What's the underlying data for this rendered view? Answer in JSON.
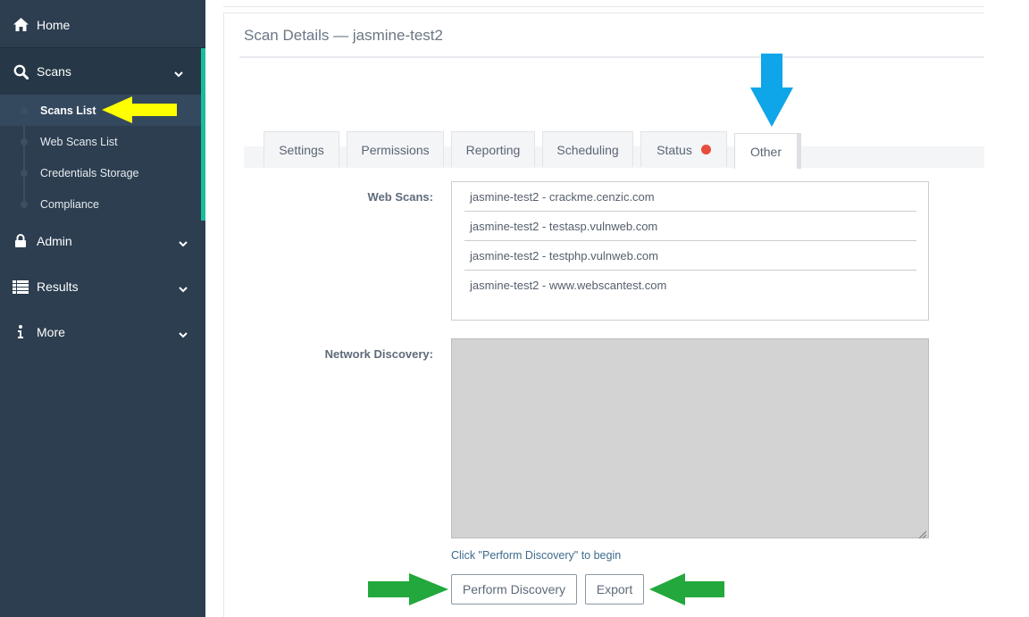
{
  "sidebar": {
    "home": {
      "label": "Home",
      "icon": "home-icon"
    },
    "scans": {
      "label": "Scans",
      "icon": "search-icon"
    },
    "scans_sub": [
      {
        "label": "Scans List"
      },
      {
        "label": "Web Scans List"
      },
      {
        "label": "Credentials Storage"
      },
      {
        "label": "Compliance"
      }
    ],
    "admin": {
      "label": "Admin",
      "icon": "lock-icon"
    },
    "results": {
      "label": "Results",
      "icon": "list-icon"
    },
    "more": {
      "label": "More",
      "icon": "info-icon"
    }
  },
  "page": {
    "title": "Scan Details — jasmine-test2"
  },
  "tabs": [
    {
      "label": "Settings"
    },
    {
      "label": "Permissions"
    },
    {
      "label": "Reporting"
    },
    {
      "label": "Scheduling"
    },
    {
      "label": "Status"
    },
    {
      "label": "Other"
    }
  ],
  "web_scans": {
    "label": "Web Scans:",
    "items": [
      "jasmine-test2 - crackme.cenzic.com",
      "jasmine-test2 - testasp.vulnweb.com",
      "jasmine-test2 - testphp.vulnweb.com",
      "jasmine-test2 - www.webscantest.com"
    ]
  },
  "network_discovery": {
    "label": "Network Discovery:",
    "hint": "Click \"Perform Discovery\" to begin"
  },
  "buttons": {
    "perform_discovery": "Perform Discovery",
    "export": "Export"
  },
  "colors": {
    "sidebar_bg": "#2c3e50",
    "accent": "#1abc9c",
    "status_red": "#e74c3c",
    "annotation_yellow": "#ffff00",
    "annotation_blue": "#0ea5e9",
    "annotation_green": "#22a83c"
  }
}
